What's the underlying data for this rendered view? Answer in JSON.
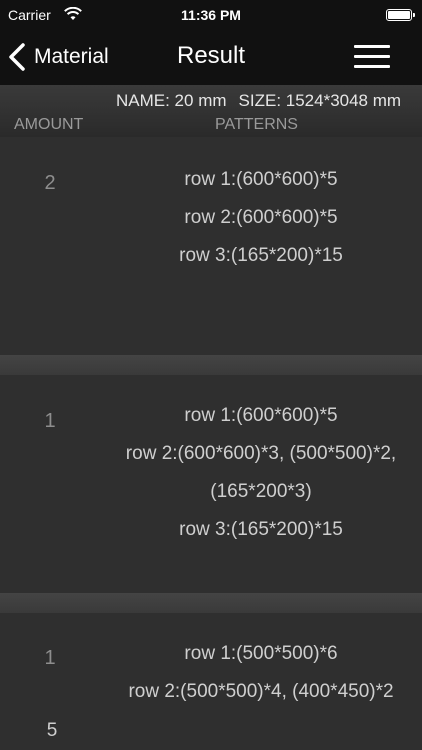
{
  "status": {
    "carrier": "Carrier",
    "time": "11:36 PM"
  },
  "nav": {
    "back_label": "Material",
    "title": "Result"
  },
  "info": {
    "name": "NAME: 20 mm",
    "size": "SIZE: 1524*3048 mm",
    "col_amount": "AMOUNT",
    "col_patterns": "PATTERNS"
  },
  "results": [
    {
      "amount": "2",
      "lines": [
        "row 1:(600*600)*5",
        "row 2:(600*600)*5",
        "row 3:(165*200)*15"
      ]
    },
    {
      "amount": "1",
      "lines": [
        "row 1:(600*600)*5",
        "row 2:(600*600)*3, (500*500)*2,",
        "(165*200*3)",
        "row 3:(165*200)*15"
      ]
    },
    {
      "amount": "1",
      "lines": [
        "row 1:(500*500)*6",
        "row 2:(500*500)*4, (400*450)*2"
      ]
    }
  ],
  "footer": {
    "count": "5"
  }
}
